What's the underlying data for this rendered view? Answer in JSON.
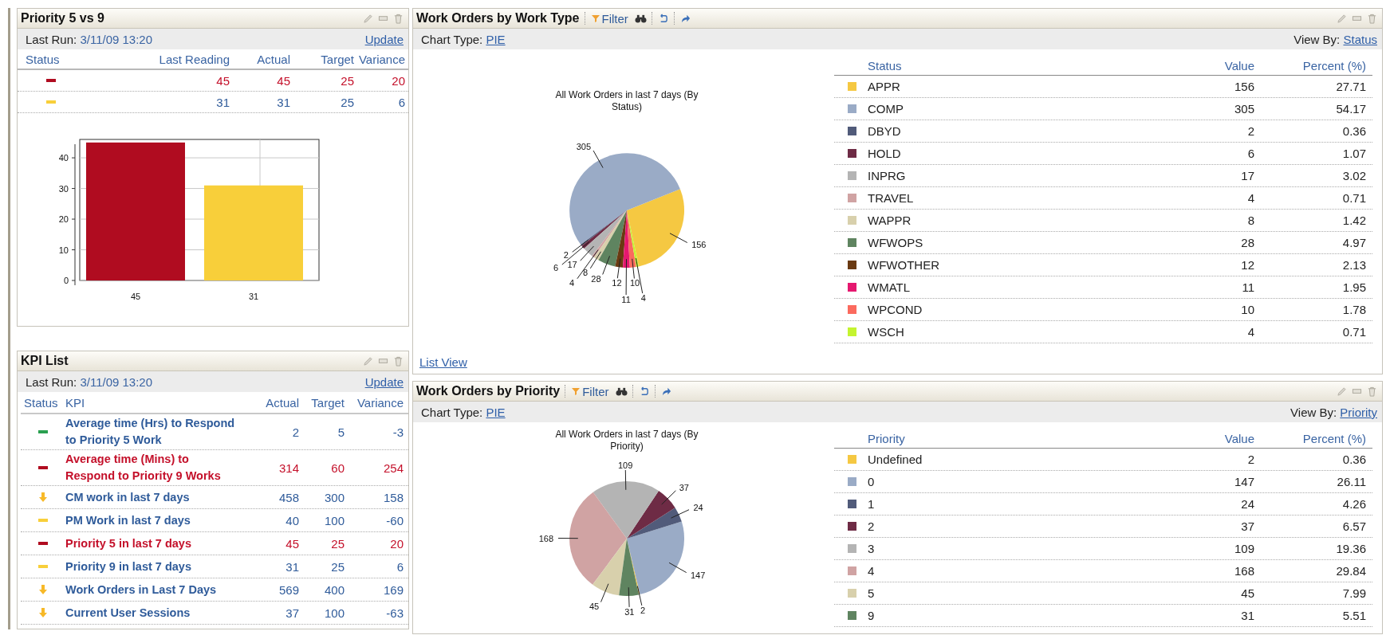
{
  "priority_panel": {
    "title": "Priority 5 vs 9",
    "last_run_label": "Last Run:",
    "last_run_value": "3/11/09 13:20",
    "update_link": "Update",
    "columns": [
      "Status",
      "Last Reading",
      "Actual",
      "Target",
      "Variance"
    ],
    "rows": [
      {
        "status": {
          "kind": "dash",
          "color": "#b00c20"
        },
        "alert": true,
        "last_reading": "45",
        "actual": "45",
        "target": "25",
        "variance": "20"
      },
      {
        "status": {
          "kind": "dash",
          "color": "#f8cf3a"
        },
        "alert": false,
        "last_reading": "31",
        "actual": "31",
        "target": "25",
        "variance": "6"
      }
    ],
    "chart_data": {
      "type": "bar",
      "categories": [
        "45",
        "31"
      ],
      "values": [
        45,
        31
      ],
      "ylim": [
        0,
        46
      ],
      "yticks": [
        0,
        10,
        20,
        30,
        40
      ],
      "grid": true
    }
  },
  "chart_panels": [
    {
      "title": "Work Orders by Work Type",
      "filter_label": "Filter",
      "chart_type_label": "Chart Type:",
      "chart_type_value": "PIE",
      "view_by_label": "View By:",
      "view_by_value": "Status",
      "chart_data": {
        "type": "pie",
        "title": "All Work Orders in last 7 days (By Status)",
        "categories": [
          "APPR",
          "COMP",
          "DBYD",
          "HOLD",
          "INPRG",
          "TRAVEL",
          "WAPPR",
          "WFWOPS",
          "WFWOTHER",
          "WMATL",
          "WPCOND",
          "WSCH"
        ],
        "values": [
          156,
          305,
          2,
          6,
          17,
          4,
          8,
          28,
          12,
          11,
          10,
          4
        ],
        "data_labels": true
      },
      "legend_table": {
        "columns": [
          "Status",
          "Value",
          "Percent (%)"
        ],
        "rows": [
          {
            "color": "#f5c842",
            "value": "156",
            "percent": "27.71"
          },
          {
            "color": "#9aabc6",
            "value": "305",
            "percent": "54.17"
          },
          {
            "color": "#515b7a",
            "value": "2",
            "percent": "0.36"
          },
          {
            "color": "#6e2b45",
            "value": "6",
            "percent": "1.07"
          },
          {
            "color": "#b4b4b4",
            "value": "17",
            "percent": "3.02"
          },
          {
            "color": "#d0a3a3",
            "value": "4",
            "percent": "0.71"
          },
          {
            "color": "#d8d0ac",
            "value": "8",
            "percent": "1.42"
          },
          {
            "color": "#5f8460",
            "value": "28",
            "percent": "4.97"
          },
          {
            "color": "#6a3a12",
            "value": "12",
            "percent": "2.13"
          },
          {
            "color": "#e5186f",
            "value": "11",
            "percent": "1.95"
          },
          {
            "color": "#fb6a5e",
            "value": "10",
            "percent": "1.78"
          },
          {
            "color": "#c4f430",
            "value": "4",
            "percent": "0.71"
          }
        ]
      },
      "list_view_link": "List View"
    },
    {
      "title": "Work Orders by Priority",
      "filter_label": "Filter",
      "chart_type_label": "Chart Type:",
      "chart_type_value": "PIE",
      "view_by_label": "View By:",
      "view_by_value": "Priority",
      "chart_data": {
        "type": "pie",
        "title": "All Work Orders in last 7 days (By Priority)",
        "categories": [
          "Undefined",
          "0",
          "1",
          "2",
          "3",
          "4",
          "5",
          "9"
        ],
        "values": [
          2,
          147,
          24,
          37,
          109,
          168,
          45,
          31
        ],
        "data_labels": true
      },
      "legend_table": {
        "columns": [
          "Priority",
          "Value",
          "Percent (%)"
        ],
        "rows": [
          {
            "color": "#f5c842",
            "value": "2",
            "percent": "0.36"
          },
          {
            "color": "#9aabc6",
            "value": "147",
            "percent": "26.11"
          },
          {
            "color": "#515b7a",
            "value": "24",
            "percent": "4.26"
          },
          {
            "color": "#6e2b45",
            "value": "37",
            "percent": "6.57"
          },
          {
            "color": "#b4b4b4",
            "value": "109",
            "percent": "19.36"
          },
          {
            "color": "#d0a3a3",
            "value": "168",
            "percent": "29.84"
          },
          {
            "color": "#d8d0ac",
            "value": "45",
            "percent": "7.99"
          },
          {
            "color": "#5f8460",
            "value": "31",
            "percent": "5.51"
          }
        ]
      }
    }
  ],
  "kpi_list": {
    "title": "KPI List",
    "last_run_label": "Last Run:",
    "last_run_value": "3/11/09 13:20",
    "update_link": "Update",
    "columns": [
      "Status",
      "KPI",
      "Actual",
      "Target",
      "Variance"
    ],
    "rows": [
      {
        "status": {
          "kind": "dash",
          "color": "#2aa050"
        },
        "alert": false,
        "kpi": "Average time (Hrs) to Respond to Priority 5 Work",
        "actual": "2",
        "target": "5",
        "variance": "-3"
      },
      {
        "status": {
          "kind": "dash",
          "color": "#b00c20"
        },
        "alert": true,
        "kpi": "Average time (Mins) to Respond to Priority 9 Works",
        "actual": "314",
        "target": "60",
        "variance": "254"
      },
      {
        "status": {
          "kind": "arrow",
          "color": "#f7b928"
        },
        "alert": false,
        "kpi": "CM work in last 7 days",
        "actual": "458",
        "target": "300",
        "variance": "158"
      },
      {
        "status": {
          "kind": "dash",
          "color": "#f8cf3a"
        },
        "alert": false,
        "kpi": "PM Work in last 7 days",
        "actual": "40",
        "target": "100",
        "variance": "-60"
      },
      {
        "status": {
          "kind": "dash",
          "color": "#b00c20"
        },
        "alert": true,
        "kpi": "Priority 5 in last 7 days",
        "actual": "45",
        "target": "25",
        "variance": "20"
      },
      {
        "status": {
          "kind": "dash",
          "color": "#f8cf3a"
        },
        "alert": false,
        "kpi": "Priority 9 in last 7 days",
        "actual": "31",
        "target": "25",
        "variance": "6"
      },
      {
        "status": {
          "kind": "arrow",
          "color": "#f7b928"
        },
        "alert": false,
        "kpi": "Work Orders in Last 7 Days",
        "actual": "569",
        "target": "400",
        "variance": "169"
      },
      {
        "status": {
          "kind": "arrow",
          "color": "#f7b928"
        },
        "alert": false,
        "kpi": "Current User Sessions",
        "actual": "37",
        "target": "100",
        "variance": "-63"
      }
    ]
  }
}
